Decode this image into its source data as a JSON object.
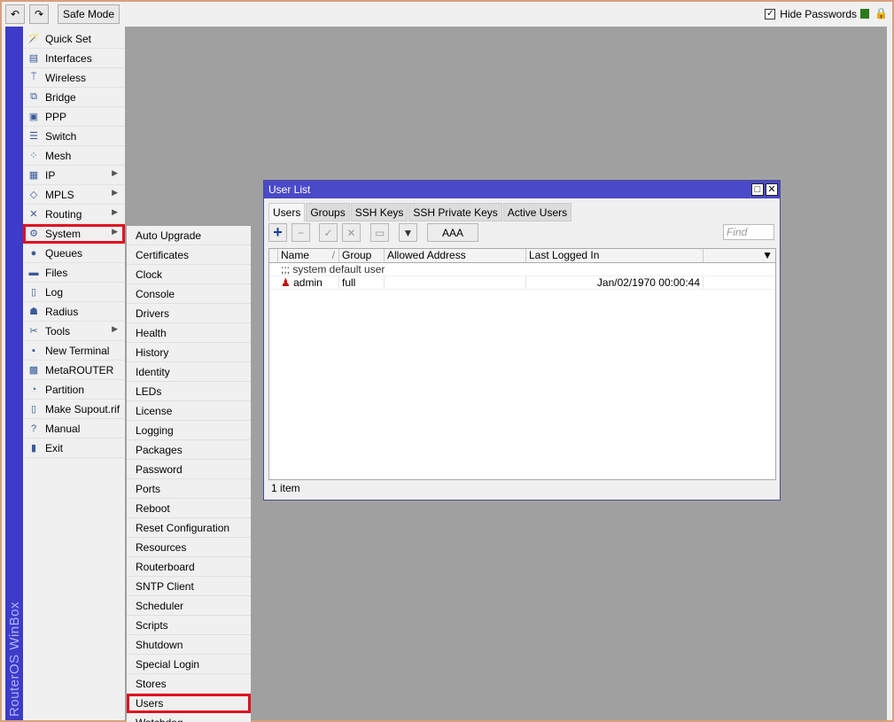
{
  "toolbar": {
    "safe_mode": "Safe Mode",
    "hide_passwords": "Hide Passwords",
    "hide_passwords_checked": true
  },
  "brand": "RouterOS WinBox",
  "menu": [
    {
      "label": "Quick Set",
      "icon": "wand-icon",
      "submenu": false
    },
    {
      "label": "Interfaces",
      "icon": "interfaces-icon",
      "submenu": false
    },
    {
      "label": "Wireless",
      "icon": "wireless-icon",
      "submenu": false
    },
    {
      "label": "Bridge",
      "icon": "bridge-icon",
      "submenu": false
    },
    {
      "label": "PPP",
      "icon": "ppp-icon",
      "submenu": false
    },
    {
      "label": "Switch",
      "icon": "switch-icon",
      "submenu": false
    },
    {
      "label": "Mesh",
      "icon": "mesh-icon",
      "submenu": false
    },
    {
      "label": "IP",
      "icon": "ip-icon",
      "submenu": true
    },
    {
      "label": "MPLS",
      "icon": "mpls-icon",
      "submenu": true
    },
    {
      "label": "Routing",
      "icon": "routing-icon",
      "submenu": true
    },
    {
      "label": "System",
      "icon": "gear-icon",
      "submenu": true,
      "selected": true
    },
    {
      "label": "Queues",
      "icon": "queues-icon",
      "submenu": false
    },
    {
      "label": "Files",
      "icon": "folder-icon",
      "submenu": false
    },
    {
      "label": "Log",
      "icon": "log-icon",
      "submenu": false
    },
    {
      "label": "Radius",
      "icon": "radius-icon",
      "submenu": false
    },
    {
      "label": "Tools",
      "icon": "tools-icon",
      "submenu": true
    },
    {
      "label": "New Terminal",
      "icon": "terminal-icon",
      "submenu": false
    },
    {
      "label": "MetaROUTER",
      "icon": "metarouter-icon",
      "submenu": false
    },
    {
      "label": "Partition",
      "icon": "partition-icon",
      "submenu": false
    },
    {
      "label": "Make Supout.rif",
      "icon": "document-icon",
      "submenu": false
    },
    {
      "label": "Manual",
      "icon": "help-icon",
      "submenu": false
    },
    {
      "label": "Exit",
      "icon": "exit-icon",
      "submenu": false
    }
  ],
  "submenu": [
    "Auto Upgrade",
    "Certificates",
    "Clock",
    "Console",
    "Drivers",
    "Health",
    "History",
    "Identity",
    "LEDs",
    "License",
    "Logging",
    "Packages",
    "Password",
    "Ports",
    "Reboot",
    "Reset Configuration",
    "Resources",
    "Routerboard",
    "SNTP Client",
    "Scheduler",
    "Scripts",
    "Shutdown",
    "Special Login",
    "Stores",
    "Users",
    "Watchdog"
  ],
  "submenu_selected": "Users",
  "window": {
    "title": "User List",
    "tabs": [
      "Users",
      "Groups",
      "SSH Keys",
      "SSH Private Keys",
      "Active Users"
    ],
    "active_tab": "Users",
    "aaa": "AAA",
    "find_placeholder": "Find",
    "columns": [
      "Name",
      "Group",
      "Allowed Address",
      "Last Logged In"
    ],
    "comment": ";;; system default user",
    "rows": [
      {
        "name": "admin",
        "group": "full",
        "allowed_address": "",
        "last_logged_in": "Jan/02/1970 00:00:44"
      }
    ],
    "count": "1 item"
  },
  "colors": {
    "title_bar": "#4a4ac8",
    "highlight": "#e01020",
    "desktop": "#a0a0a0"
  }
}
